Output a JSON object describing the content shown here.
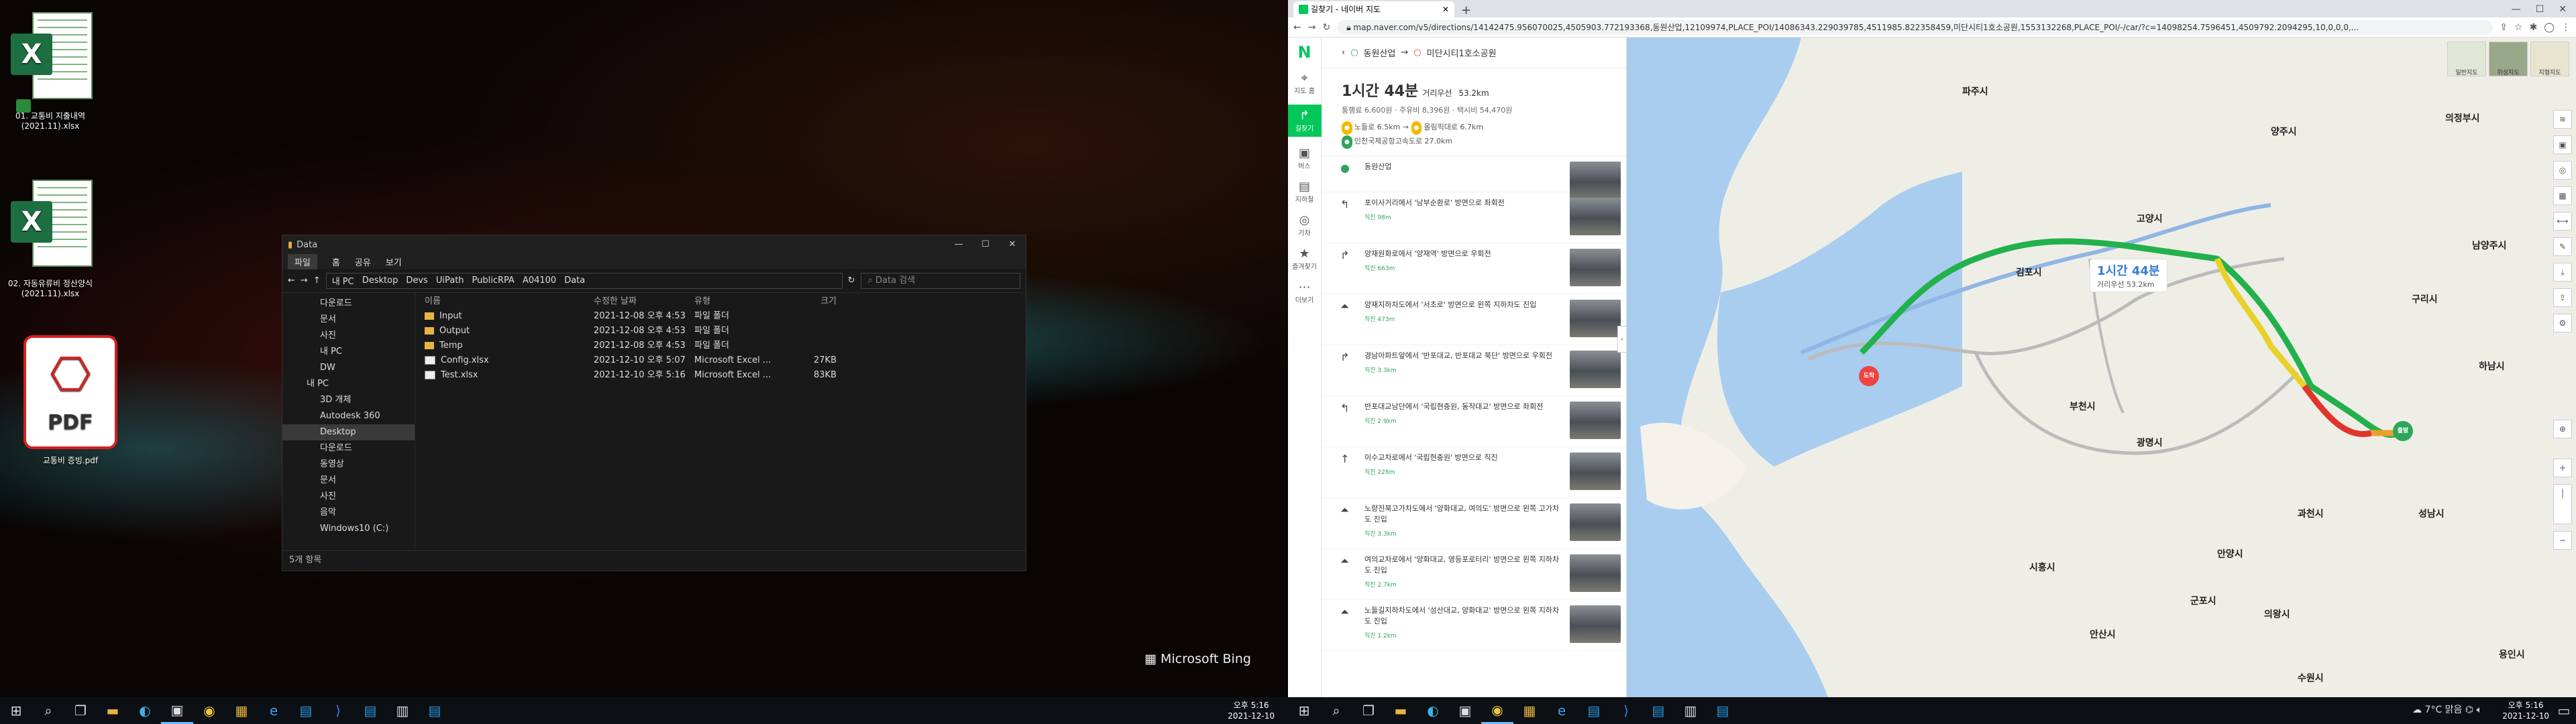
{
  "desktop": {
    "icons": [
      {
        "label": "01. 교통비 지출내역(2021.11).xlsx",
        "type": "excel"
      },
      {
        "label": "02. 자동유류비 정산양식(2021.11).xlsx",
        "type": "excel"
      },
      {
        "label": "교통비 증빙.pdf",
        "type": "pdf"
      }
    ],
    "excel_glyph": "X",
    "pdf_glyph": "PDF",
    "watermark": "Microsoft Bing"
  },
  "explorer": {
    "title": "Data",
    "ribbon": [
      "파일",
      "홈",
      "공유",
      "보기"
    ],
    "breadcrumb": [
      "내 PC",
      "Desktop",
      "Devs",
      "UiPath",
      "PublicRPA",
      "A04100",
      "Data"
    ],
    "search_placeholder": "Data 검색",
    "nav": [
      {
        "label": "다운로드",
        "level": "sub"
      },
      {
        "label": "문서",
        "level": "sub"
      },
      {
        "label": "사진",
        "level": "sub"
      },
      {
        "label": "내 PC",
        "level": "sub"
      },
      {
        "label": "DW",
        "level": "sub"
      },
      {
        "label": "내 PC",
        "level": "top"
      },
      {
        "label": "3D 개체",
        "level": "sub"
      },
      {
        "label": "Autodesk 360",
        "level": "sub"
      },
      {
        "label": "Desktop",
        "level": "sub",
        "selected": true
      },
      {
        "label": "다운로드",
        "level": "sub"
      },
      {
        "label": "동영상",
        "level": "sub"
      },
      {
        "label": "문서",
        "level": "sub"
      },
      {
        "label": "사진",
        "level": "sub"
      },
      {
        "label": "음악",
        "level": "sub"
      },
      {
        "label": "Windows10 (C:)",
        "level": "sub"
      }
    ],
    "columns": [
      "이름",
      "수정한 날짜",
      "유형",
      "크기"
    ],
    "files": [
      {
        "name": "Input",
        "date": "2021-12-08 오후 4:53",
        "type": "파일 폴더",
        "size": "",
        "kind": "folder"
      },
      {
        "name": "Output",
        "date": "2021-12-08 오후 4:53",
        "type": "파일 폴더",
        "size": "",
        "kind": "folder"
      },
      {
        "name": "Temp",
        "date": "2021-12-08 오후 4:53",
        "type": "파일 폴더",
        "size": "",
        "kind": "folder"
      },
      {
        "name": "Config.xlsx",
        "date": "2021-12-10 오후 5:07",
        "type": "Microsoft Excel ...",
        "size": "27KB",
        "kind": "file"
      },
      {
        "name": "Test.xlsx",
        "date": "2021-12-10 오후 5:16",
        "type": "Microsoft Excel ...",
        "size": "83KB",
        "kind": "file"
      }
    ],
    "status": "5개 항목"
  },
  "taskbar1": {
    "time": "오후 5:16",
    "date": "2021-12-10"
  },
  "taskbar2": {
    "time": "오후 5:16",
    "date": "2021-12-10",
    "weather": "7°C 맑음"
  },
  "browser": {
    "tab_title": "길찾기 - 네이버 지도",
    "url": "map.naver.com/v5/directions/14142475.956070025,4505903.772193368,동원산업,12109974,PLACE_POI/14086343.229039785,4511985.822358459,미단시티1호소공원,1553132268,PLACE_POI/-/car/?c=14098254.7596451,4509792.2094295,10,0,0,0,..."
  },
  "navermap": {
    "logo": "N",
    "menu": [
      "지도 홈",
      "길찾기",
      "버스",
      "지하철",
      "기차",
      "즐겨찾기",
      "더보기"
    ],
    "origin": "동원산업",
    "destination": "미단시티1호소공원",
    "duration": "1시간 44분",
    "distance_label": "거리우선",
    "distance": "53.2km",
    "fees": "통행료 6,600원 · 주유비 8,396원 · 택시비 54,470원",
    "via": [
      "노들로 6.5km",
      "올림픽대로 6.7km",
      "인천국제공항고속도로 27.0km"
    ],
    "steps": [
      {
        "text": "동원산업",
        "dist": ""
      },
      {
        "text": "포이사거리에서 '남부순환로' 방면으로 좌회전",
        "dist": "직진 98m"
      },
      {
        "text": "양재원화로에서 '양재역' 방면으로 우회전",
        "dist": "직진 663m"
      },
      {
        "text": "양재지하차도에서 '서초로' 방면으로 왼쪽 지하차도 진입",
        "dist": "직진 473m"
      },
      {
        "text": "경남아파트앞에서 '반포대교, 반포대교 북단' 방면으로 우회전",
        "dist": "직진 3.3km"
      },
      {
        "text": "반포대교남단에서 '국립현충원, 동작대교' 방면으로 좌회전",
        "dist": "직진 2.9km"
      },
      {
        "text": "이수교차로에서 '국립현충원' 방면으로 직진",
        "dist": "직진 228m"
      },
      {
        "text": "노량진북고가차도에서 '양화대교, 여의도' 방면으로 왼쪽 고가차도 진입",
        "dist": "직진 3.3km"
      },
      {
        "text": "여의교차로에서 '양화대교, 영등포로터리' 방면으로 왼쪽 지하차도 진입",
        "dist": "직진 2.7km"
      },
      {
        "text": "노들길지하차도에서 '성산대교, 양화대교' 방면으로 왼쪽 지하차도 진입",
        "dist": "직진 1.2km"
      }
    ],
    "map_summary_time": "1시간 44분",
    "map_summary_dist": "거리우선 53.2km",
    "layers": [
      "일반지도",
      "위성지도",
      "지형지도"
    ],
    "place_labels": [
      "파주시",
      "김포시",
      "고양시",
      "양주시",
      "의정부시",
      "남양주시",
      "구리시",
      "하남시",
      "부천시",
      "광명시",
      "과천시",
      "성남시",
      "안양시",
      "군포시",
      "시흥시",
      "안산시",
      "의왕시",
      "수원시",
      "용인시"
    ],
    "origin_pin": "출발",
    "dest_pin": "도착"
  }
}
